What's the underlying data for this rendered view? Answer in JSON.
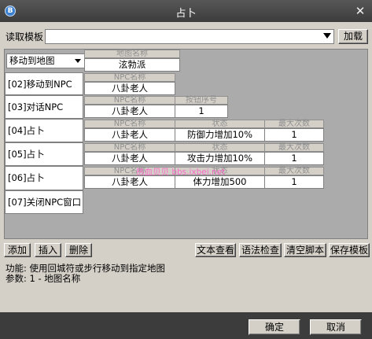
{
  "window": {
    "title": "占卜",
    "icon": "app-icon",
    "close_glyph": "✕"
  },
  "template_row": {
    "label": "读取模板",
    "value": "",
    "load_button": "加载"
  },
  "rows": [
    {
      "command": "移动到地图",
      "type": "select",
      "fields": [
        {
          "header": "地图名称",
          "value": "泫勃派"
        }
      ]
    },
    {
      "command": "[02]移动到NPC",
      "fields": [
        {
          "header": "NPC名称",
          "value": "八卦老人"
        }
      ]
    },
    {
      "command": "[03]对话NPC",
      "fields": [
        {
          "header": "NPC名称",
          "value": "八卦老人"
        },
        {
          "header": "按钮序号",
          "value": "1"
        }
      ]
    },
    {
      "command": "[04]占卜",
      "fields": [
        {
          "header": "NPC名称",
          "value": "八卦老人"
        },
        {
          "header": "状态",
          "value": "防御力增加10%"
        },
        {
          "header": "最大次数",
          "value": "1"
        }
      ]
    },
    {
      "command": "[05]占卜",
      "fields": [
        {
          "header": "NPC名称",
          "value": "八卦老人"
        },
        {
          "header": "状态",
          "value": "攻击力增加10%"
        },
        {
          "header": "最大次数",
          "value": "1"
        }
      ]
    },
    {
      "command": "[06]占卜",
      "fields": [
        {
          "header": "NPC名称",
          "value": "八卦老人"
        },
        {
          "header": "状态",
          "value": "体力增加500"
        },
        {
          "header": "最大次数",
          "value": "1"
        }
      ]
    },
    {
      "command": "[07]关闭NPC窗口",
      "fields": []
    }
  ],
  "watermark": "热血贝贝 bbs.ixbei.net",
  "toolbar_left": {
    "add": "添加",
    "insert": "插入",
    "delete": "删除"
  },
  "toolbar_right": {
    "view_text": "文本查看",
    "syntax_check": "语法检查",
    "clear_script": "清空脚本",
    "save_template": "保存模板"
  },
  "info": {
    "function": "功能: 使用回城符或步行移动到指定地图",
    "params": "参数: 1 - 地图名称"
  },
  "footer": {
    "ok": "确定",
    "cancel": "取消"
  }
}
